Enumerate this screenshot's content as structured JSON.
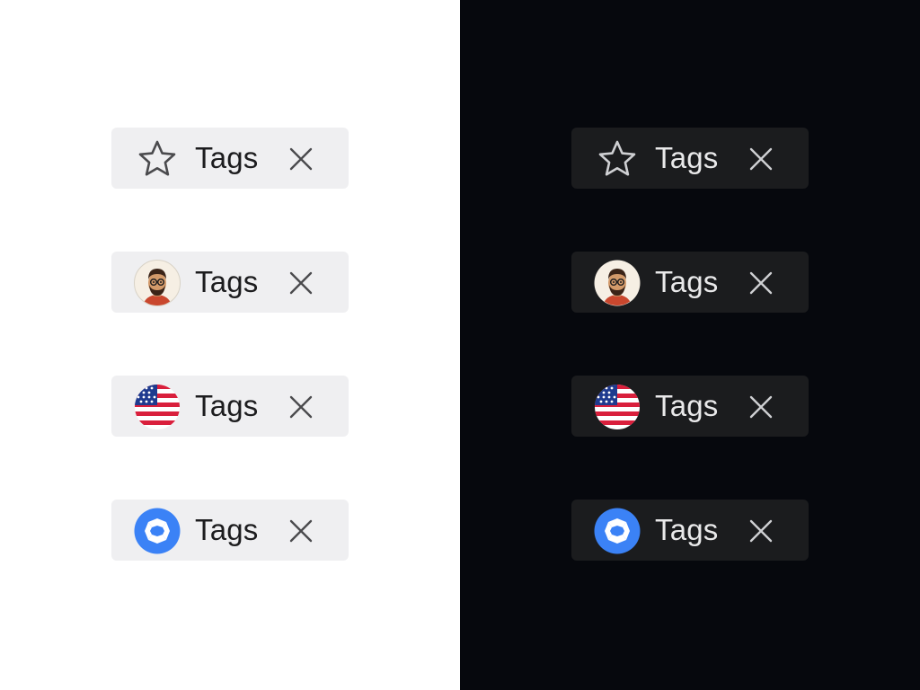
{
  "light": {
    "tags": [
      {
        "label": "Tags",
        "icon": "star-icon"
      },
      {
        "label": "Tags",
        "icon": "avatar"
      },
      {
        "label": "Tags",
        "icon": "us-flag-icon"
      },
      {
        "label": "Tags",
        "icon": "brand-logo-icon"
      }
    ]
  },
  "dark": {
    "tags": [
      {
        "label": "Tags",
        "icon": "star-icon"
      },
      {
        "label": "Tags",
        "icon": "avatar"
      },
      {
        "label": "Tags",
        "icon": "us-flag-icon"
      },
      {
        "label": "Tags",
        "icon": "brand-logo-icon"
      }
    ]
  },
  "colors": {
    "light_bg": "#ffffff",
    "dark_bg": "#06080d",
    "light_tag_bg": "#efeff1",
    "dark_tag_bg": "#1b1c1e",
    "brand_blue": "#3b82f6",
    "flag_red": "#d91f3c",
    "flag_blue": "#1f3b8f"
  }
}
